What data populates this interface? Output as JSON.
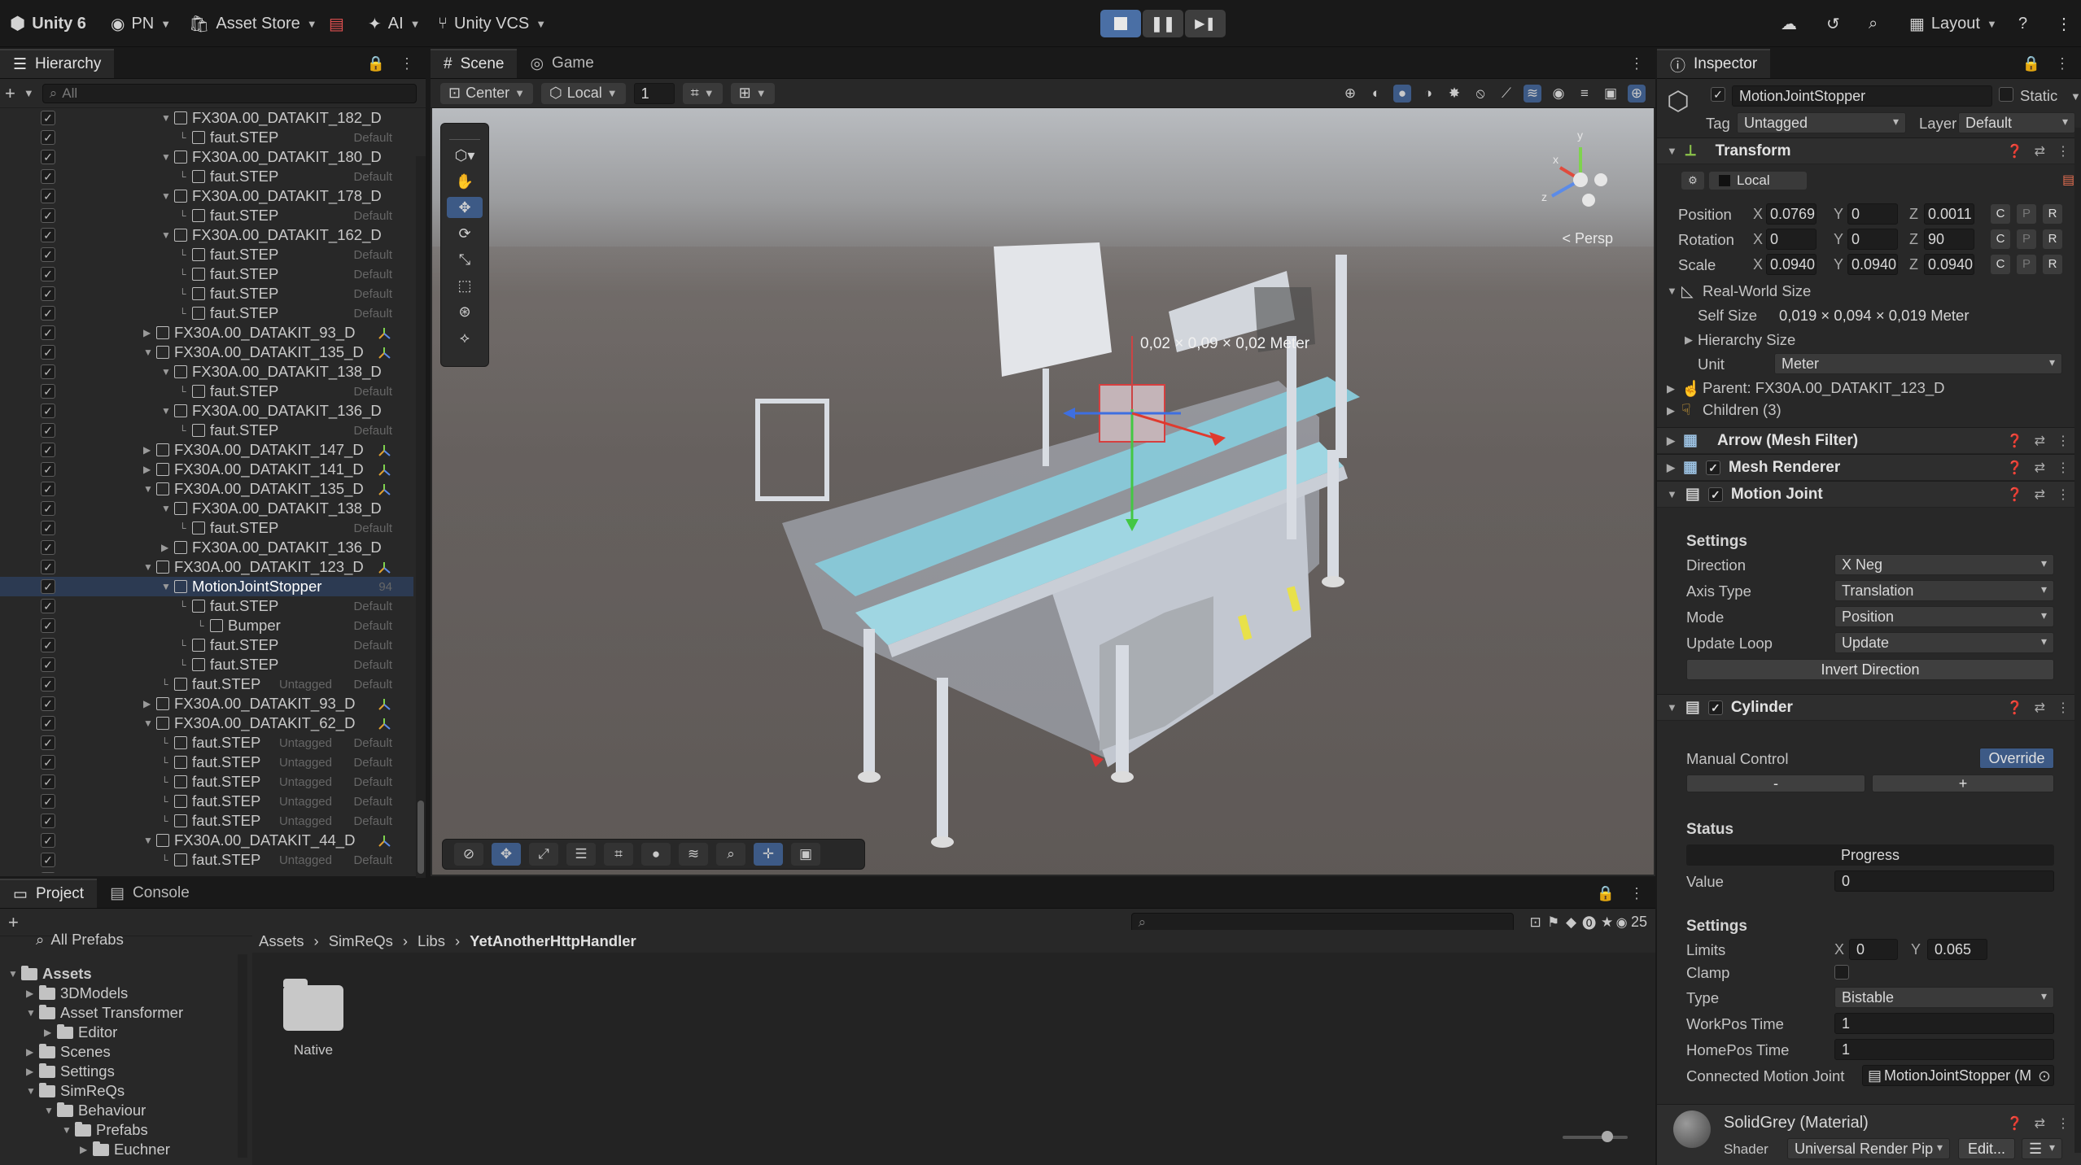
{
  "topbar": {
    "app_title": "Unity 6",
    "account": "PN",
    "asset_store": "Asset Store",
    "ai": "AI",
    "vcs": "Unity VCS",
    "layout": "Layout"
  },
  "hierarchy": {
    "tab": "Hierarchy",
    "search_placeholder": "All",
    "rows": [
      {
        "label": "FX30A.00_DATAKIT_182_D",
        "depth": 1,
        "kind": "object",
        "expanded": true,
        "tag": "",
        "layer": ""
      },
      {
        "label": "faut.STEP",
        "depth": 2,
        "kind": "mesh",
        "tag": "",
        "layer": "Default"
      },
      {
        "label": "FX30A.00_DATAKIT_180_D",
        "depth": 1,
        "kind": "object",
        "expanded": true,
        "tag": "",
        "layer": ""
      },
      {
        "label": "faut.STEP",
        "depth": 2,
        "kind": "mesh",
        "tag": "",
        "layer": "Default"
      },
      {
        "label": "FX30A.00_DATAKIT_178_D",
        "depth": 1,
        "kind": "object",
        "expanded": true,
        "tag": "",
        "layer": ""
      },
      {
        "label": "faut.STEP",
        "depth": 2,
        "kind": "mesh",
        "tag": "",
        "layer": "Default"
      },
      {
        "label": "FX30A.00_DATAKIT_162_D",
        "depth": 1,
        "kind": "object",
        "expanded": true,
        "tag": "",
        "layer": ""
      },
      {
        "label": "faut.STEP",
        "depth": 2,
        "kind": "mesh",
        "tag": "",
        "layer": "Default"
      },
      {
        "label": "faut.STEP",
        "depth": 2,
        "kind": "mesh",
        "tag": "",
        "layer": "Default"
      },
      {
        "label": "faut.STEP",
        "depth": 2,
        "kind": "mesh",
        "tag": "",
        "layer": "Default"
      },
      {
        "label": "faut.STEP",
        "depth": 2,
        "kind": "mesh",
        "tag": "",
        "layer": "Default"
      },
      {
        "label": "FX30A.00_DATAKIT_93_D",
        "depth": 0,
        "kind": "object",
        "expanded": false,
        "tag": "",
        "layer": "",
        "bone": true
      },
      {
        "label": "FX30A.00_DATAKIT_135_D",
        "depth": 0,
        "kind": "object",
        "expanded": true,
        "tag": "",
        "layer": "",
        "bone": true
      },
      {
        "label": "FX30A.00_DATAKIT_138_D",
        "depth": 1,
        "kind": "object",
        "expanded": true,
        "tag": "",
        "layer": ""
      },
      {
        "label": "faut.STEP",
        "depth": 2,
        "kind": "mesh",
        "tag": "",
        "layer": "Default"
      },
      {
        "label": "FX30A.00_DATAKIT_136_D",
        "depth": 1,
        "kind": "object",
        "expanded": true,
        "tag": "",
        "layer": ""
      },
      {
        "label": "faut.STEP",
        "depth": 2,
        "kind": "mesh",
        "tag": "",
        "layer": "Default"
      },
      {
        "label": "FX30A.00_DATAKIT_147_D",
        "depth": 0,
        "kind": "object",
        "expanded": false,
        "tag": "",
        "layer": "",
        "bone": true
      },
      {
        "label": "FX30A.00_DATAKIT_141_D",
        "depth": 0,
        "kind": "object",
        "expanded": false,
        "tag": "",
        "layer": "",
        "bone": true
      },
      {
        "label": "FX30A.00_DATAKIT_135_D",
        "depth": 0,
        "kind": "object",
        "expanded": true,
        "tag": "",
        "layer": "",
        "bone": true
      },
      {
        "label": "FX30A.00_DATAKIT_138_D",
        "depth": 1,
        "kind": "object",
        "expanded": true,
        "tag": "",
        "layer": ""
      },
      {
        "label": "faut.STEP",
        "depth": 2,
        "kind": "mesh",
        "tag": "",
        "layer": "Default"
      },
      {
        "label": "FX30A.00_DATAKIT_136_D",
        "depth": 1,
        "kind": "object",
        "expanded": false,
        "tag": "",
        "layer": ""
      },
      {
        "label": "FX30A.00_DATAKIT_123_D",
        "depth": 0,
        "kind": "object",
        "expanded": true,
        "tag": "",
        "layer": "",
        "bone": true
      },
      {
        "label": "MotionJointStopper",
        "depth": 1,
        "kind": "object",
        "expanded": true,
        "tag": "",
        "layer": "94",
        "selected": true
      },
      {
        "label": "faut.STEP",
        "depth": 2,
        "kind": "mesh",
        "tag": "",
        "layer": "Default"
      },
      {
        "label": "Bumper",
        "depth": 3,
        "kind": "mesh",
        "tag": "",
        "layer": "Default"
      },
      {
        "label": "faut.STEP",
        "depth": 2,
        "kind": "mesh",
        "tag": "",
        "layer": "Default"
      },
      {
        "label": "faut.STEP",
        "depth": 2,
        "kind": "mesh",
        "tag": "",
        "layer": "Default"
      },
      {
        "label": "faut.STEP",
        "depth": 1,
        "kind": "mesh",
        "tag": "Untagged",
        "layer": "Default"
      },
      {
        "label": "FX30A.00_DATAKIT_93_D",
        "depth": 0,
        "kind": "object",
        "expanded": false,
        "tag": "",
        "layer": "",
        "bone": true
      },
      {
        "label": "FX30A.00_DATAKIT_62_D",
        "depth": 0,
        "kind": "object",
        "expanded": true,
        "tag": "",
        "layer": "",
        "bone": true
      },
      {
        "label": "faut.STEP",
        "depth": 1,
        "kind": "mesh",
        "tag": "Untagged",
        "layer": "Default"
      },
      {
        "label": "faut.STEP",
        "depth": 1,
        "kind": "mesh",
        "tag": "Untagged",
        "layer": "Default"
      },
      {
        "label": "faut.STEP",
        "depth": 1,
        "kind": "mesh",
        "tag": "Untagged",
        "layer": "Default"
      },
      {
        "label": "faut.STEP",
        "depth": 1,
        "kind": "mesh",
        "tag": "Untagged",
        "layer": "Default"
      },
      {
        "label": "faut.STEP",
        "depth": 1,
        "kind": "mesh",
        "tag": "Untagged",
        "layer": "Default"
      },
      {
        "label": "FX30A.00_DATAKIT_44_D",
        "depth": 0,
        "kind": "object",
        "expanded": true,
        "tag": "",
        "layer": "",
        "bone": true
      },
      {
        "label": "faut.STEP",
        "depth": 1,
        "kind": "mesh",
        "tag": "Untagged",
        "layer": "Default"
      },
      {
        "label": "faut.STEP",
        "depth": 1,
        "kind": "mesh",
        "tag": "Untagged",
        "layer": "Default"
      }
    ]
  },
  "scene": {
    "tab_scene": "Scene",
    "tab_game": "Game",
    "pivot": "Center",
    "space": "Local",
    "grid_value": "1",
    "persp": "< Persp",
    "dimension_label": "0,02 × 0,09 × 0,02 Meter"
  },
  "inspector": {
    "tab": "Inspector",
    "object_name": "MotionJointStopper",
    "static_label": "Static",
    "tag_label": "Tag",
    "tag_value": "Untagged",
    "layer_label": "Layer",
    "layer_value": "Default",
    "transform": {
      "title": "Transform",
      "space": "Local",
      "position_label": "Position",
      "rotation_label": "Rotation",
      "scale_label": "Scale",
      "position": {
        "x": "0.0769",
        "y": "0",
        "z": "0.0011"
      },
      "rotation": {
        "x": "0",
        "y": "0",
        "z": "90"
      },
      "scale": {
        "x": "0.0940",
        "y": "0.0940",
        "z": "0.0940"
      },
      "c": "C",
      "p": "P",
      "r": "R",
      "real_world_size": "Real-World Size",
      "self_size_label": "Self Size",
      "self_size_value": "0,019 × 0,094 × 0,019  Meter",
      "hierarchy_size": "Hierarchy Size",
      "unit_label": "Unit",
      "unit_value": "Meter",
      "parent": "Parent: FX30A.00_DATAKIT_123_D",
      "children": "Children (3)"
    },
    "mesh_filter": "Arrow (Mesh Filter)",
    "mesh_renderer": "Mesh Renderer",
    "motion_joint": {
      "title": "Motion Joint",
      "settings": "Settings",
      "direction_label": "Direction",
      "direction_value": "X Neg",
      "axis_label": "Axis Type",
      "axis_value": "Translation",
      "mode_label": "Mode",
      "mode_value": "Position",
      "update_label": "Update Loop",
      "update_value": "Update",
      "invert_button": "Invert Direction"
    },
    "cylinder": {
      "title": "Cylinder",
      "manual_control": "Manual Control",
      "override": "Override",
      "minus": "-",
      "plus": "+",
      "status": "Status",
      "progress": "Progress",
      "value_label": "Value",
      "value": "0",
      "settings": "Settings",
      "limits_label": "Limits",
      "limit_x": "0",
      "limit_y": "0.065",
      "x": "X",
      "y": "Y",
      "clamp_label": "Clamp",
      "type_label": "Type",
      "type_value": "Bistable",
      "workpos_label": "WorkPos Time",
      "workpos_value": "1",
      "homepos_label": "HomePos Time",
      "homepos_value": "1",
      "connected_label": "Connected Motion Joint",
      "connected_value": "MotionJointStopper (M"
    },
    "material": {
      "name": "SolidGrey (Material)",
      "shader_label": "Shader",
      "shader_value": "Universal Render Pip",
      "edit": "Edit..."
    }
  },
  "project": {
    "tab_project": "Project",
    "tab_console": "Console",
    "favorites": "All Prefabs",
    "count": "25",
    "breadcrumb": [
      "Assets",
      "SimReQs",
      "Libs",
      "YetAnotherHttpHandler"
    ],
    "tree": [
      {
        "label": "Assets",
        "depth": 0,
        "expanded": true,
        "bold": true
      },
      {
        "label": "3DModels",
        "depth": 1,
        "expanded": false
      },
      {
        "label": "Asset Transformer",
        "depth": 1,
        "expanded": true
      },
      {
        "label": "Editor",
        "depth": 2,
        "expanded": false
      },
      {
        "label": "Scenes",
        "depth": 1,
        "expanded": false
      },
      {
        "label": "Settings",
        "depth": 1,
        "expanded": false
      },
      {
        "label": "SimReQs",
        "depth": 1,
        "expanded": true
      },
      {
        "label": "Behaviour",
        "depth": 2,
        "expanded": true
      },
      {
        "label": "Prefabs",
        "depth": 3,
        "expanded": true
      },
      {
        "label": "Euchner",
        "depth": 4,
        "expanded": false
      }
    ],
    "items": [
      {
        "label": "Native",
        "kind": "folder"
      }
    ]
  },
  "colors": {
    "accent": "#4a6fa5",
    "selection": "#2c3a52",
    "panel": "#282828",
    "override": "#3d5a86"
  }
}
